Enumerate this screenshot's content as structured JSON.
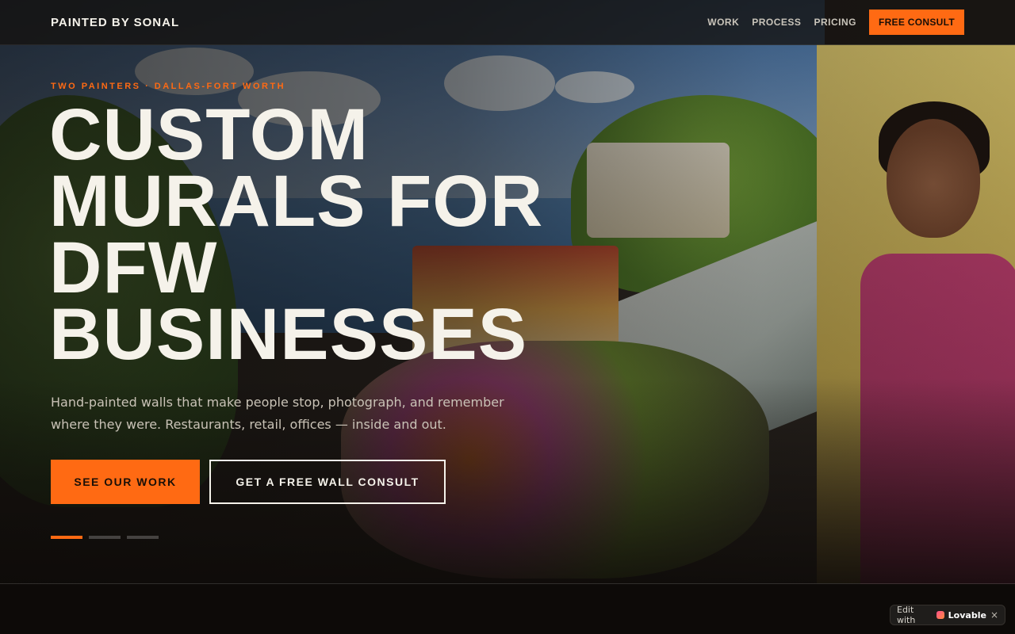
{
  "nav": {
    "brand": "PAINTED BY SONAL",
    "links": [
      "WORK",
      "PROCESS",
      "PRICING"
    ],
    "cta": "FREE CONSULT"
  },
  "hero": {
    "eyebrow": "TWO PAINTERS · DALLAS-FORT WORTH",
    "headline_lines": [
      "CUSTOM",
      "MURALS FOR",
      "DFW",
      "BUSINESSES"
    ],
    "subhead": "Hand-painted walls that make people stop, photograph, and remember where they were. Restaurants, retail, offices — inside and out.",
    "primary_button": "SEE OUR WORK",
    "secondary_button": "GET A FREE WALL CONSULT",
    "slides": {
      "count": 3,
      "active": 1
    }
  },
  "badge": {
    "prefix": "Edit with",
    "brand": "Lovable",
    "close": "×"
  },
  "colors": {
    "accent": "#ff6a13",
    "background": "#0d0a08",
    "text": "#f5f2ea"
  }
}
